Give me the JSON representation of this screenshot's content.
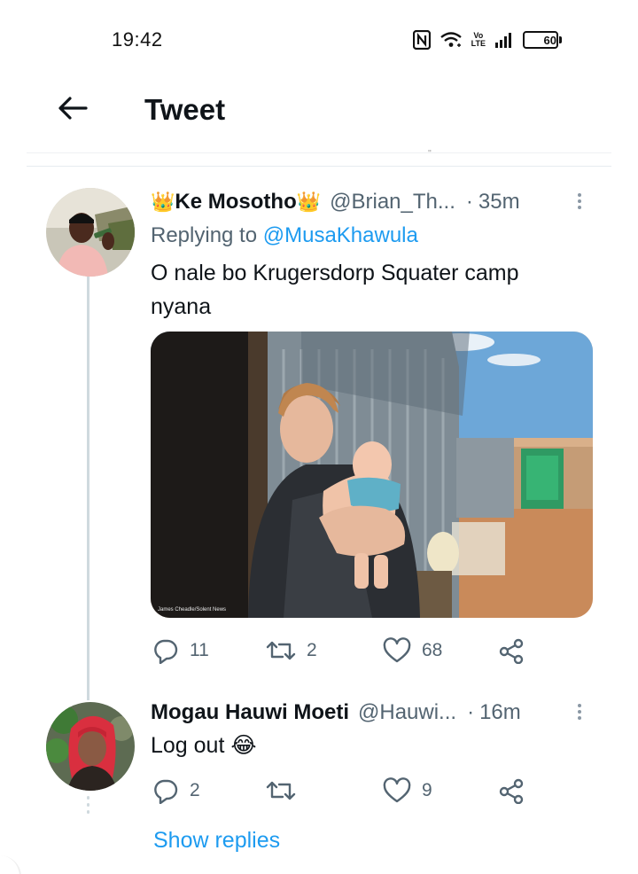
{
  "status_bar": {
    "time": "19:42",
    "network_label": "Vo\nLTE",
    "battery_level": "60",
    "battery_fraction": 0.6
  },
  "header": {
    "title": "Tweet"
  },
  "tweets": [
    {
      "display_name": "Ke Mosotho",
      "name_decoration": "👑",
      "handle": "@Brian_Th...",
      "time_ago": "35m",
      "replying_prefix": "Replying to",
      "replying_to": "@MusaKhawula",
      "text": "O nale bo Krugersdorp Squater camp nyana",
      "media_credit": "James Cheadle/Solent News",
      "replies": "11",
      "retweets": "2",
      "likes": "68"
    },
    {
      "display_name": "Mogau Hauwi Moeti",
      "handle": "@Hauwi...",
      "time_ago": "16m",
      "text": "Log out 😂",
      "replies": "2",
      "retweets": "",
      "likes": "9"
    }
  ],
  "show_replies_label": "Show replies",
  "separator": "·",
  "colors": {
    "accent": "#1d9bf0",
    "secondary_text": "#536471",
    "primary_text": "#0f1419",
    "thread_line": "#cfd9de"
  },
  "icons": [
    "back-arrow-icon",
    "nfc-icon",
    "wifi-icon",
    "signal-icon",
    "battery-icon",
    "more-vertical-icon",
    "reply-icon",
    "retweet-icon",
    "like-icon",
    "share-icon"
  ]
}
